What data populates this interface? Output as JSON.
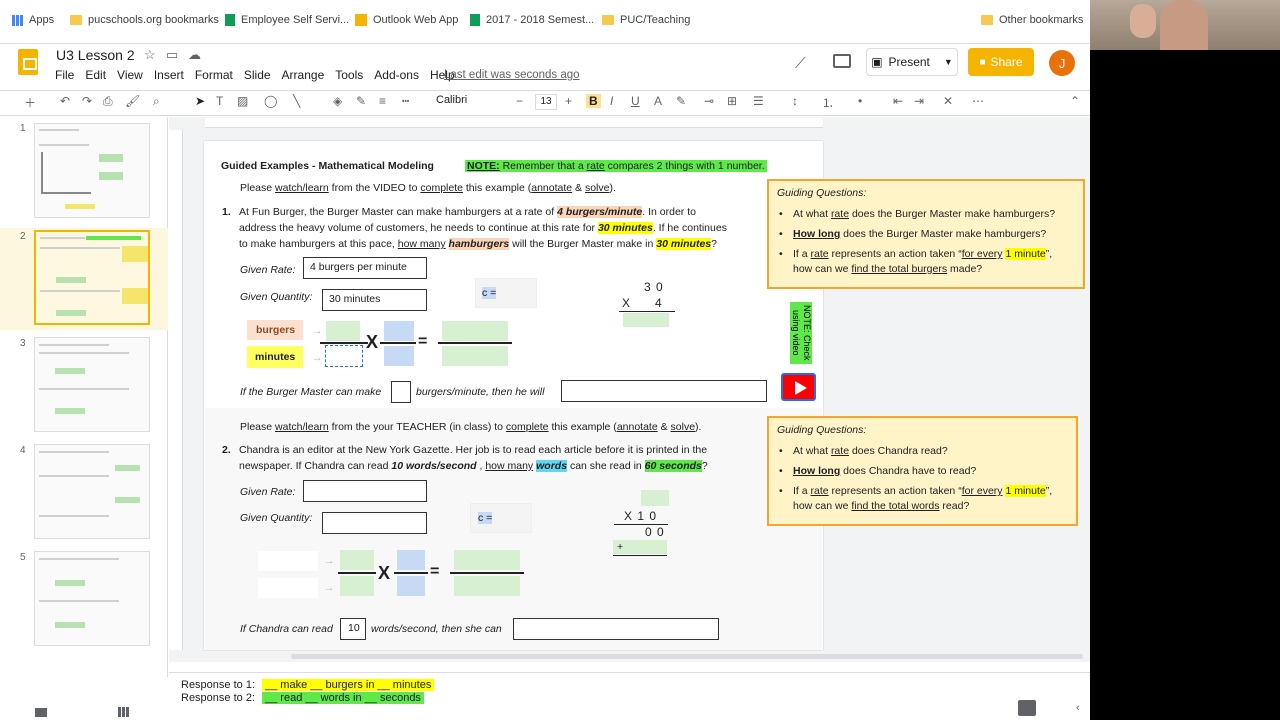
{
  "bookmarks": {
    "items": [
      "Apps",
      "pucschools.org bookmarks",
      "Employee Self Servi...",
      "Outlook Web App",
      "2017 - 2018 Semest...",
      "PUC/Teaching"
    ],
    "other": "Other bookmarks"
  },
  "app": {
    "title": "U3 Lesson 2",
    "menus": [
      "File",
      "Edit",
      "View",
      "Insert",
      "Format",
      "Slide",
      "Arrange",
      "Tools",
      "Add-ons",
      "Help"
    ],
    "last_edit": "Last edit was seconds ago",
    "present": "Present",
    "share": "Share",
    "avatar": "J"
  },
  "toolbar": {
    "font": "Calibri",
    "size": "13",
    "bold": "B",
    "italic": "I",
    "underline": "U"
  },
  "filmstrip": {
    "numbers": [
      "1",
      "2",
      "3",
      "4",
      "5"
    ]
  },
  "slide": {
    "heading": "Guided Examples - Mathematical Modeling",
    "note_banner_a": "NOTE:",
    "note_banner_b": " Remember that a ",
    "note_banner_c": "rate",
    "note_banner_d": " compares 2 things with 1 number.",
    "p1_intro": [
      "Please ",
      "watch/learn",
      " from the VIDEO to ",
      "complete",
      " this example (",
      "annotate",
      " & ",
      "solve",
      ")."
    ],
    "p1_num": "1.",
    "p1_line1": [
      "At Fun Burger, the Burger Master can make hamburgers at a rate of ",
      "4 burgers/minute",
      ".  In order to"
    ],
    "p1_line2": [
      "address the heavy volume of customers, he needs to continue at this rate for ",
      "30 minutes",
      ".  If he continues"
    ],
    "p1_line3": [
      "to make hamburgers at this pace, ",
      "how many",
      " ",
      "hamburgers",
      " will the Burger Master make in ",
      "30 minutes",
      "?"
    ],
    "given_rate_label": "Given Rate:",
    "given_rate_value": "4 burgers per minute",
    "given_qty_label": "Given Quantity:",
    "given_qty_value": "30 minutes",
    "c_eq": "c =",
    "mult_top": "3 0",
    "mult_x": "X",
    "mult_bottom": "4",
    "label_burgers": "burgers",
    "label_minutes": "minutes",
    "times": "X",
    "equals": "=",
    "if_line_a": "If the Burger Master can make",
    "if_line_b": "burgers/minute, then he will",
    "p2_intro": [
      "Please ",
      "watch/learn",
      " from the your TEACHER (in class) to ",
      "complete",
      " this example (",
      "annotate",
      " & ",
      "solve",
      ")."
    ],
    "p2_num": "2.",
    "p2_line1": "Chandra is an editor at the New York Gazette. Her job is to read each article before it is printed in the",
    "p2_line2": [
      "newspaper. If Chandra can read ",
      "10 words/second",
      "  , ",
      "how many",
      " ",
      "words",
      " can she read in ",
      "60 seconds",
      "?"
    ],
    "given_rate_label2": "Given Rate:",
    "given_qty_label2": "Given Quantity:",
    "c_eq2": "c =",
    "mult2_x": "X  1 0",
    "mult2_mid": "0 0",
    "mult2_plus": "+",
    "if2_a": "If Chandra can read",
    "if2_val": "10",
    "if2_b": "words/second, then she can",
    "vnote": "NOTE: Check using video"
  },
  "guide1": {
    "title": "Guiding Questions:",
    "q1": [
      "At what ",
      "rate",
      " does the Burger Master make hamburgers?"
    ],
    "q2": [
      "How long",
      " does the Burger Master make hamburgers?"
    ],
    "q3": [
      "If a ",
      "rate",
      " represents an action taken “",
      "for every",
      " ",
      "1 minute",
      "”,"
    ],
    "q3b": [
      "how can we ",
      "find the total burgers",
      " made?"
    ]
  },
  "guide2": {
    "title": "Guiding Questions:",
    "q1": [
      "At what ",
      "rate",
      " does Chandra read?"
    ],
    "q2": [
      "How long",
      " does Chandra have to read?"
    ],
    "q3": [
      "If a ",
      "rate",
      " represents an action taken “",
      "for every",
      " ",
      "1 minute",
      "”,"
    ],
    "q3b": [
      "how can we ",
      "find the total words",
      " read?"
    ]
  },
  "notes": {
    "r1_label": "Response to 1:",
    "r1_value": "__ make __ burgers in __ minutes",
    "r2_label": "Response to 2:",
    "r2_value": "__ read __ words in __ seconds"
  },
  "colors": {
    "accent": "#f4b400",
    "guide_border": "#f0a732",
    "green_hl": "#5ee84a",
    "yellow_hl": "#ffff00"
  }
}
